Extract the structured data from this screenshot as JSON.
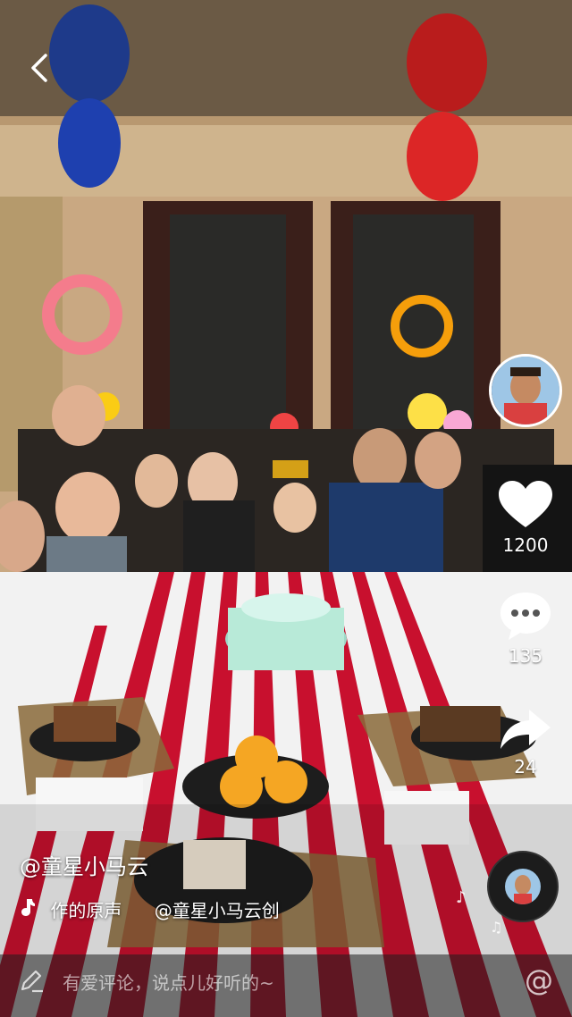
{
  "video": {
    "scene": "birthday-party-video"
  },
  "nav": {
    "back_icon": "chevron-left-icon"
  },
  "rail": {
    "avatar_icon": "creator-avatar",
    "like": {
      "icon": "heart-icon",
      "count": "1200"
    },
    "comment": {
      "icon": "comment-bubble-icon",
      "count": "135"
    },
    "share": {
      "icon": "share-arrow-icon",
      "count": "24"
    }
  },
  "caption": {
    "author": "@童星小马云",
    "music_prefix": "作的原声",
    "music_author": "@童星小马云创"
  },
  "comment_bar": {
    "edit_icon": "pencil-icon",
    "placeholder": "有爱评论，说点儿好听的~",
    "mention_label": "@"
  },
  "colors": {
    "accent": "#ffffff",
    "table_red": "#c8102e",
    "wall": "#c9a882"
  }
}
